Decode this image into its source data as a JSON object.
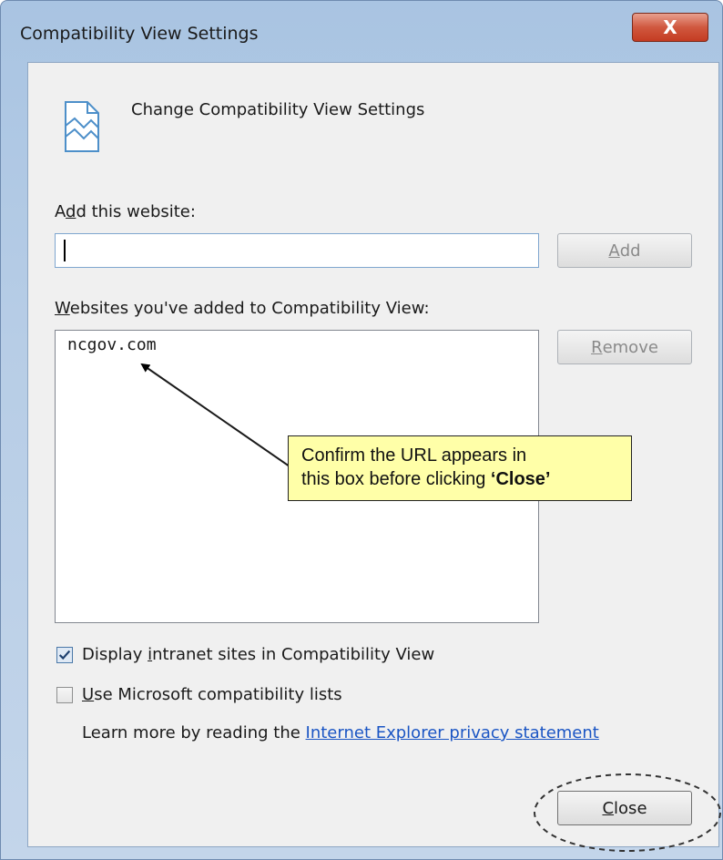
{
  "window": {
    "title": "Compatibility View Settings",
    "close_glyph": "X"
  },
  "header": {
    "icon": "page-broken-icon",
    "text": "Change Compatibility View Settings"
  },
  "add_section": {
    "label_prefix": "A",
    "label_underlined": "d",
    "label_suffix": "d this website:",
    "input_value": "",
    "add_button_underlined": "A",
    "add_button_rest": "dd"
  },
  "sites_section": {
    "label_underlined": "W",
    "label_rest": "ebsites you've added to Compatibility View:",
    "items": [
      "ncgov.com"
    ],
    "remove_button_underlined": "R",
    "remove_button_rest": "emove"
  },
  "annotation": {
    "line1": "Confirm the URL appears in",
    "line2_plain": "this box before clicking ",
    "line2_bold": "‘Close’",
    "background": "#ffffa8"
  },
  "options": {
    "intranet": {
      "checked": true,
      "label_prefix": "Display ",
      "label_underlined": "i",
      "label_suffix": "ntranet sites in Compatibility View"
    },
    "ms_lists": {
      "checked": false,
      "label_underlined": "U",
      "label_suffix": "se Microsoft compatibility lists"
    },
    "learn_more_text": "Learn more by reading the ",
    "privacy_link": "Internet Explorer privacy statement"
  },
  "footer": {
    "close_underlined": "C",
    "close_rest": "lose"
  },
  "colors": {
    "link": "#1a55c4",
    "close_x_button": "#c43b22"
  }
}
